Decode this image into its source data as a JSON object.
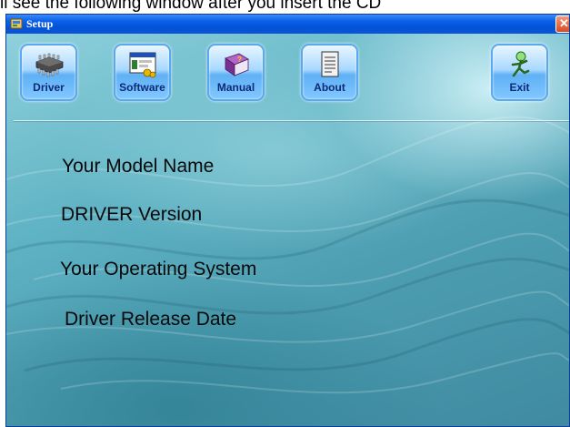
{
  "caption": "ll see the following window after you insert the CD",
  "window": {
    "title": "Setup",
    "close_symbol": "✕"
  },
  "toolbar": {
    "buttons": [
      {
        "label": "Driver",
        "icon": "chip-icon"
      },
      {
        "label": "Software",
        "icon": "software-window-icon"
      },
      {
        "label": "Manual",
        "icon": "book-icon"
      },
      {
        "label": "About",
        "icon": "document-icon"
      },
      {
        "label": "Exit",
        "icon": "running-man-icon"
      }
    ]
  },
  "info": {
    "model_name": "Your Model Name",
    "driver_version": "DRIVER Version",
    "operating_system": "Your Operating System",
    "release_date": "Driver Release Date"
  }
}
